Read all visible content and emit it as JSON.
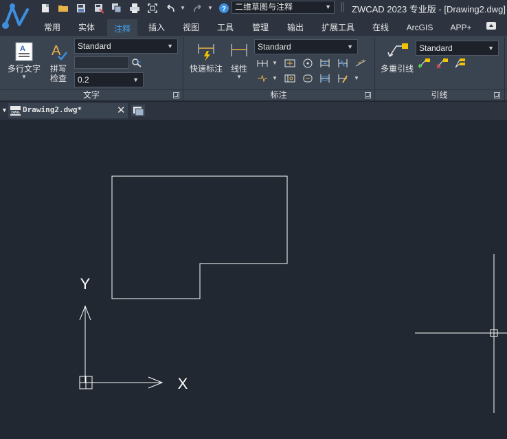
{
  "app": {
    "window_title": "ZWCAD 2023 专业版 - [Drawing2.dwg]",
    "workspace": "二维草图与注释"
  },
  "quick_access": {
    "icons": [
      "new-icon",
      "open-icon",
      "save-icon",
      "save-as-icon",
      "publish-icon",
      "print-icon",
      "zoom-extents-icon",
      "undo-icon",
      "redo-icon",
      "help-icon"
    ]
  },
  "tabs": [
    {
      "label": "常用"
    },
    {
      "label": "实体"
    },
    {
      "label": "注释",
      "active": true
    },
    {
      "label": "插入"
    },
    {
      "label": "视图"
    },
    {
      "label": "工具"
    },
    {
      "label": "管理"
    },
    {
      "label": "输出"
    },
    {
      "label": "扩展工具"
    },
    {
      "label": "在线"
    },
    {
      "label": "ArcGIS"
    },
    {
      "label": "APP+"
    }
  ],
  "ribbon": {
    "text_panel": {
      "title": "文字",
      "mtext_label": "多行文字",
      "spell_label_1": "拼写",
      "spell_label_2": "检查",
      "style_value": "Standard",
      "find_value": "",
      "height_value": "0.2"
    },
    "dim_panel": {
      "title": "标注",
      "quick_dim_label": "快速标注",
      "linear_label": "线性",
      "style_value": "Standard"
    },
    "leader_panel": {
      "title": "引线",
      "mleader_label": "多重引线",
      "style_value": "Standard"
    }
  },
  "document": {
    "tab_label": "Drawing2.dwg*",
    "file_badge": "DWG"
  },
  "canvas": {
    "ucs_x_label": "X",
    "ucs_y_label": "Y",
    "colors": {
      "background": "#222831",
      "geometry": "#ffffff"
    }
  }
}
